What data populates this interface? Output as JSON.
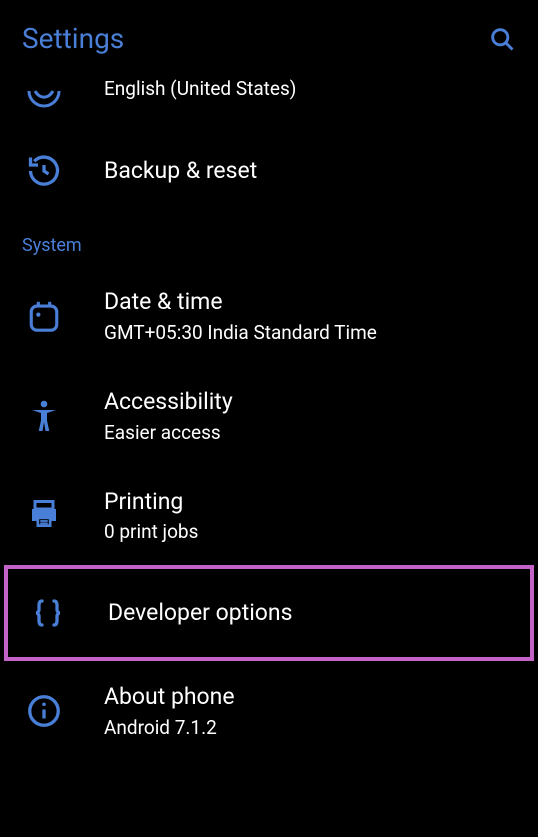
{
  "header": {
    "title": "Settings"
  },
  "partial_item": {
    "subtitle": "English (United States)"
  },
  "items": {
    "backup": {
      "title": "Backup & reset"
    },
    "datetime": {
      "title": "Date & time",
      "subtitle": "GMT+05:30 India Standard Time"
    },
    "accessibility": {
      "title": "Accessibility",
      "subtitle": "Easier access"
    },
    "printing": {
      "title": "Printing",
      "subtitle": "0 print jobs"
    },
    "developer": {
      "title": "Developer options"
    },
    "about": {
      "title": "About phone",
      "subtitle": "Android 7.1.2"
    }
  },
  "sections": {
    "system": "System"
  }
}
